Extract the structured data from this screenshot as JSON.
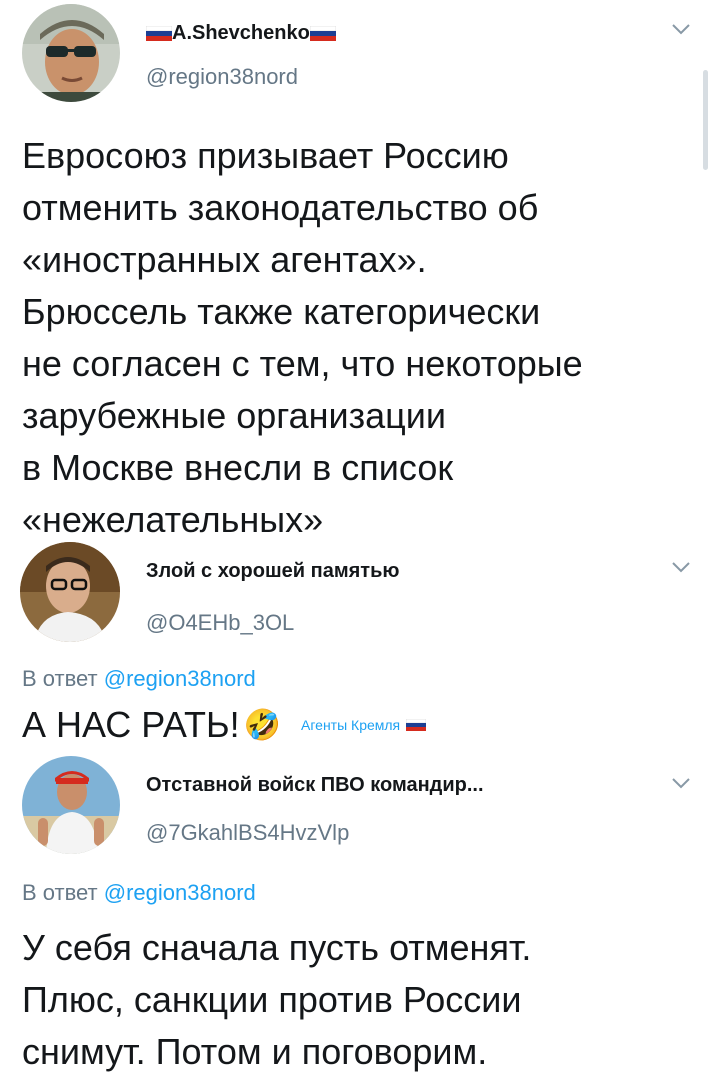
{
  "tweets": [
    {
      "display_name": "A.Shevchenko",
      "handle": "@region38nord",
      "text": "Евросоюз призывает Россию\nотменить законодательство об\n«иностранных агентах».\nБрюссель также категорически\nне согласен с тем, что некоторые\nзарубежные организации\nв Москве внесли в список\n«нежелательных»",
      "avatar_icon": "man-sunglasses-avatar"
    },
    {
      "display_name": "Злой с хорошей памятью",
      "handle": "@O4EHb_3OL",
      "reply_prefix": "В ответ",
      "reply_mention": "@region38nord",
      "text": "А НАС РАТЬ!",
      "emoji": "🤣",
      "watermark": "Агенты Кремля",
      "avatar_icon": "man-glasses-avatar"
    },
    {
      "display_name": "Отставной войск ПВО командир...",
      "handle": "@7GkahlBS4HvzVlp",
      "reply_prefix": "В ответ",
      "reply_mention": "@region38nord",
      "text": "У себя сначала пусть отменят.\nПлюс, санкции против России\nснимут. Потом и поговорим.",
      "avatar_icon": "man-red-cap-avatar"
    }
  ],
  "colors": {
    "text": "#14171a",
    "secondary": "#657786",
    "link": "#1da1f2",
    "flag_white": "#ffffff",
    "flag_blue": "#1c3f94",
    "flag_red": "#d52b1e"
  },
  "icons": {
    "menu": "chevron-down-icon",
    "flag": "russia-flag-icon"
  }
}
